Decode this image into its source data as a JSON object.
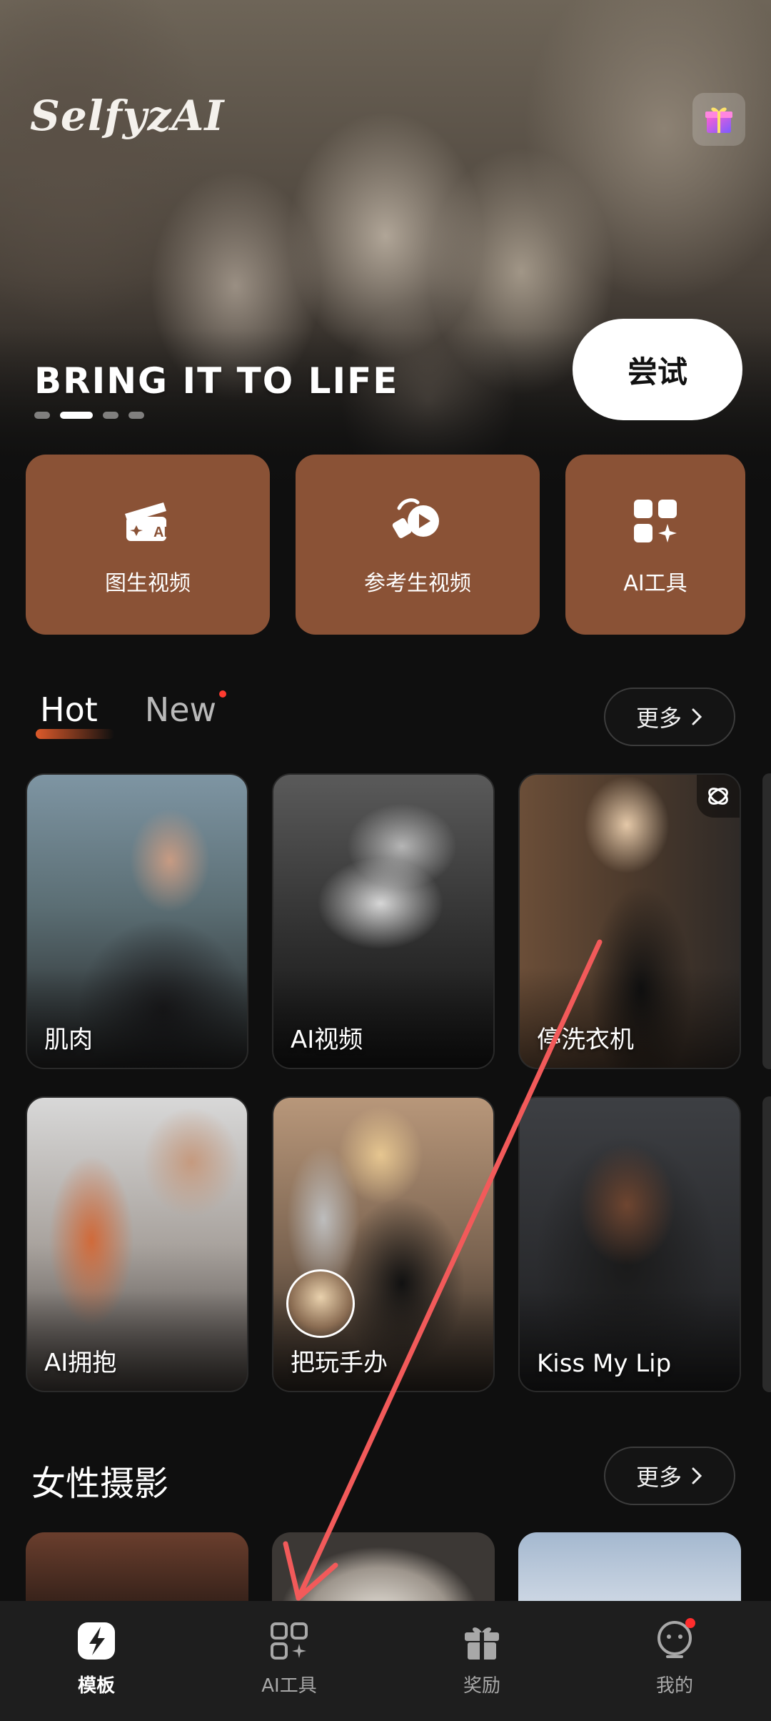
{
  "app": {
    "brand": "SelfyzAI"
  },
  "hero": {
    "headline": "BRING IT TO LIFE",
    "try_label": "尝试",
    "slides_total": 4,
    "active_slide": 2
  },
  "quick_actions": [
    {
      "label": "图生视频",
      "icon": "image-to-video-ai-icon"
    },
    {
      "label": "参考生视频",
      "icon": "reference-video-icon"
    },
    {
      "label": "AI工具",
      "icon": "ai-tools-grid-icon"
    }
  ],
  "trending": {
    "tabs": [
      {
        "label": "Hot",
        "active": true
      },
      {
        "label": "New",
        "active": false,
        "has_dot": true
      }
    ],
    "more_label": "更多",
    "items": [
      {
        "label": "肌肉"
      },
      {
        "label": "AI视频"
      },
      {
        "label": "停洗衣机"
      },
      {
        "label": "AI拥抱"
      },
      {
        "label": "把玩手办"
      },
      {
        "label": "Kiss My Lip"
      }
    ]
  },
  "female_photo": {
    "title": "女性摄影",
    "more_label": "更多"
  },
  "bottom_nav": {
    "items": [
      {
        "label": "模板",
        "active": true
      },
      {
        "label": "AI工具",
        "active": false
      },
      {
        "label": "奖励",
        "active": false
      },
      {
        "label": "我的",
        "active": false,
        "has_dot": true
      }
    ]
  },
  "colors": {
    "accent_card": "#8a5236",
    "background": "#0f0f0f",
    "nav_background": "#1e1e1e",
    "notification_dot": "#ff3b30",
    "annotation_arrow": "#f25a5a"
  }
}
